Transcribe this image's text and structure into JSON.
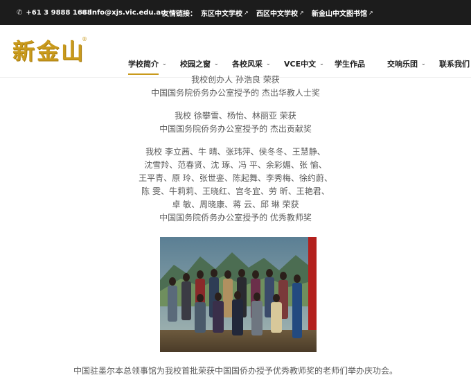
{
  "topbar": {
    "phone": "+61 3 9888 1688",
    "email": "info@xjs.vic.edu.au",
    "links_label": "友情链接：",
    "links": [
      "东区中文学校",
      "西区中文学校",
      "新金山中文图书馆"
    ]
  },
  "logo": {
    "text": "新金山",
    "reg": "®"
  },
  "nav": [
    {
      "label": "学校简介",
      "dropdown": true,
      "active": true
    },
    {
      "label": "校园之窗",
      "dropdown": true,
      "active": false
    },
    {
      "label": "各校风采",
      "dropdown": true,
      "active": false
    },
    {
      "label": "VCE中文",
      "dropdown": true,
      "active": false
    },
    {
      "label": "学生作品",
      "dropdown": false,
      "active": false
    },
    {
      "label": "交响乐团",
      "dropdown": true,
      "active": false
    },
    {
      "label": "联系我们",
      "dropdown": false,
      "active": false
    }
  ],
  "award1": [
    "我校创办人 孙浩良 荣获",
    "中国国务院侨务办公室授予的 杰出华教人士奖"
  ],
  "award2": [
    "我校 徐攀雪、杨怡、林丽亚 荣获",
    "中国国务院侨务办公室授予的 杰出贡献奖"
  ],
  "award3": [
    "我校 李立茜、牛 晴、张玮萍、侯冬冬、王慧静、",
    "沈雪羚、范春贤、沈 琢、冯 平、余彩媚、张 愉、",
    "王平青、原 玲、张世銮、陈起舞、李秀梅、徐约蔚、",
    "陈 雯、牛莉莉、王晓红、宫冬宜、劳 昕、王艳君、",
    "卓 敏、周晓康、蒋 云、邱 琳 荣获",
    "中国国务院侨务办公室授予的 优秀教师奖"
  ],
  "caption": "中国驻墨尔本总领事馆为我校首批荣获中国国侨办授予优秀教师奖的老师们举办庆功会。",
  "colors": {
    "topbar_bg": "#1c1c1c",
    "accent": "#c99a1c",
    "text": "#5a5a5a"
  },
  "icons": {
    "phone": "phone-icon",
    "email": "envelope-icon",
    "external": "external-link-icon",
    "dropdown": "chevron-down-icon"
  }
}
